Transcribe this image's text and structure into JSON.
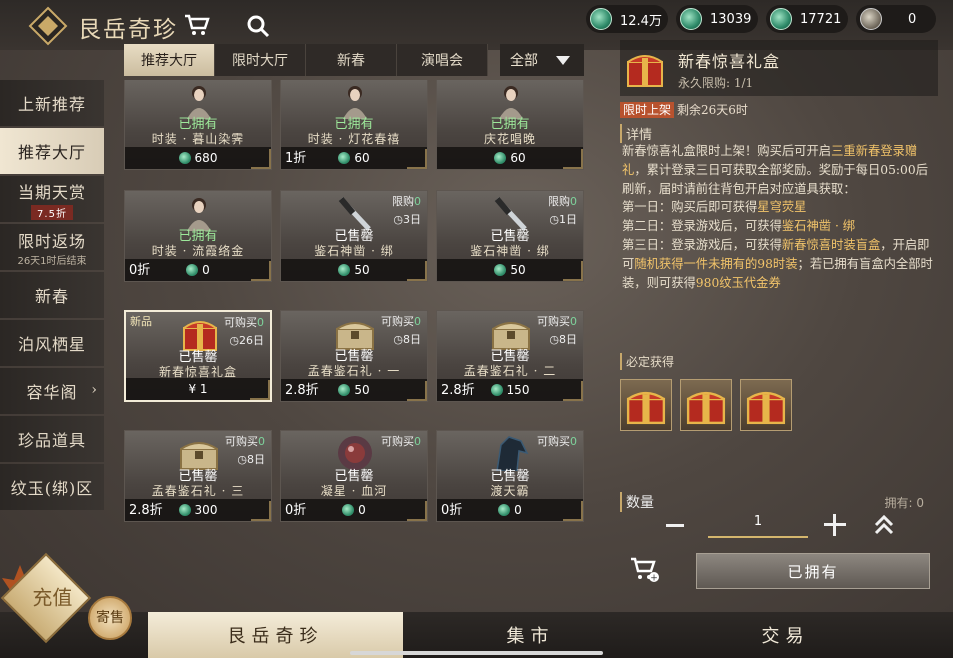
{
  "header": {
    "title": "艮岳奇珍",
    "currencies": [
      {
        "icon": "jade-plus-icon",
        "value": "12.4万"
      },
      {
        "icon": "jade-coin-icon",
        "value": "13039"
      },
      {
        "icon": "jade-bound-icon",
        "value": "17721"
      },
      {
        "icon": "token-icon",
        "value": "0"
      }
    ]
  },
  "sidebar": {
    "items": [
      {
        "label": "上新推荐"
      },
      {
        "label": "推荐大厅"
      },
      {
        "label": "当期天赏",
        "badge": "7.5折"
      },
      {
        "label": "限时返场",
        "sub": "26天1时后结束"
      },
      {
        "label": "新春"
      },
      {
        "label": "泊风栖星"
      },
      {
        "label": "容华阁"
      },
      {
        "label": "珍品道具"
      },
      {
        "label": "纹玉(绑)区"
      }
    ]
  },
  "tabs": [
    "推荐大厅",
    "限时大厅",
    "新春",
    "演唱会"
  ],
  "filter": {
    "label": "全部"
  },
  "grid": {
    "cards": [
      {
        "status": "已拥有",
        "name": "时装 · 暮山染霁",
        "price": "680",
        "disc": "",
        "limit": "",
        "days": ""
      },
      {
        "status": "已拥有",
        "name": "时装 · 灯花春禧",
        "price": "60",
        "disc": "1折",
        "limit": "",
        "days": ""
      },
      {
        "status": "已拥有",
        "name": "庆花唱晚",
        "price": "60",
        "disc": "",
        "limit": "",
        "days": ""
      },
      {
        "status": "已拥有",
        "name": "时装 · 流霞络金",
        "price": "0",
        "disc": "0折",
        "limit": "",
        "days": ""
      },
      {
        "status": "已售罄",
        "name": "鉴石神凿 · 绑",
        "price": "50",
        "disc": "",
        "limit": "限购",
        "limitn": "0",
        "days": "3日"
      },
      {
        "status": "已售罄",
        "name": "鉴石神凿 · 绑",
        "price": "50",
        "disc": "",
        "limit": "限购",
        "limitn": "0",
        "days": "1日"
      },
      {
        "status": "已售罄",
        "name": "新春惊喜礼盒",
        "price": "¥ 1",
        "disc": "",
        "limit": "可购买",
        "limitn": "0",
        "days": "26日",
        "new": "新品"
      },
      {
        "status": "已售罄",
        "name": "孟春鉴石礼 · 一",
        "price": "50",
        "disc": "2.8折",
        "limit": "可购买",
        "limitn": "0",
        "days": "8日"
      },
      {
        "status": "已售罄",
        "name": "孟春鉴石礼 · 二",
        "price": "150",
        "disc": "2.8折",
        "limit": "可购买",
        "limitn": "0",
        "days": "8日"
      },
      {
        "status": "已售罄",
        "name": "孟春鉴石礼 · 三",
        "price": "300",
        "disc": "2.8折",
        "limit": "可购买",
        "limitn": "0",
        "days": "8日"
      },
      {
        "status": "已售罄",
        "name": "凝星 · 血河",
        "price": "0",
        "disc": "0折",
        "limit": "可购买",
        "limitn": "0",
        "days": ""
      },
      {
        "status": "已售罄",
        "name": "渡天霸",
        "price": "0",
        "disc": "0折",
        "limit": "可购买",
        "limitn": "0",
        "days": ""
      }
    ]
  },
  "detail": {
    "title": "新春惊喜礼盒",
    "limit": "永久限购: 1/1",
    "tag": "限时上架",
    "remain": "剩余26天6时",
    "section": "详情",
    "desc1": "新春惊喜礼盒限时上架！购买后可开启",
    "desc1hl": "三重新春登录赠礼",
    "desc2": "，累计登录三日可获取全部奖励。奖励于每日05:00后刷新，届时请前往背包开启对应道具获取：",
    "day1": "第一日：购买后即可获得",
    "day1hl": "星穹荧星",
    "day2": "第二日：登录游戏后，可获得",
    "day2hl": "鉴石神凿 · 绑",
    "day3": "第三日：登录游戏后，可获得",
    "day3hl": "新春惊喜时装盲盒",
    "day3b": "，开启即可",
    "day3bhl": "随机获得一件未拥有的98时装",
    "day3c": "；若已拥有盲盒内全部时装，则可获得",
    "day3chl": "980纹玉代金券",
    "rewards_label": "必定获得",
    "qty_label": "数量",
    "owned": "拥有: 0",
    "qty": "1",
    "buy": "已拥有"
  },
  "bottom": {
    "tabs": [
      "艮岳奇珍",
      "集市",
      "交易"
    ],
    "recharge": "充值",
    "send": "寄售"
  }
}
